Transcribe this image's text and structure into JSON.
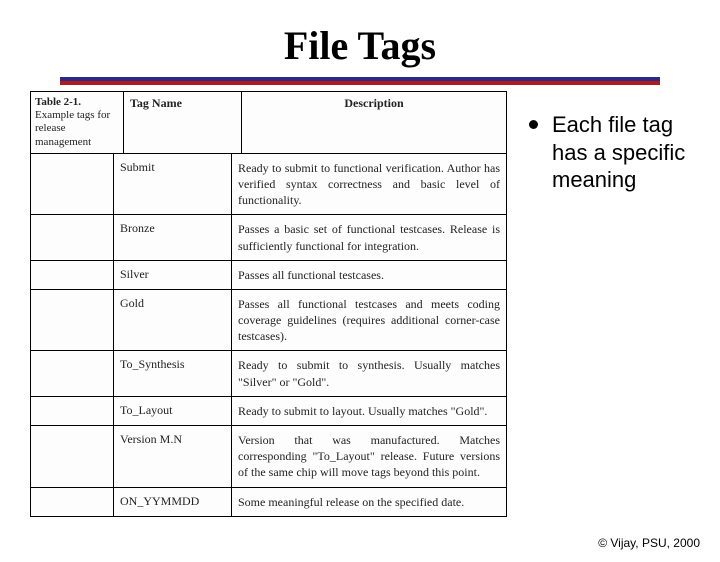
{
  "title": "File Tags",
  "side_label_line1": "Table 2-1.",
  "side_label_rest": "Example tags for release management",
  "columns": {
    "tag": "Tag Name",
    "desc": "Description"
  },
  "rows": [
    {
      "tag": "Submit",
      "desc": "Ready to submit to functional verification. Author has verified syntax correctness and basic level of functionality."
    },
    {
      "tag": "Bronze",
      "desc": "Passes a basic set of functional testcases. Release is sufficiently functional for integration."
    },
    {
      "tag": "Silver",
      "desc": "Passes all functional testcases."
    },
    {
      "tag": "Gold",
      "desc": "Passes all functional testcases and meets coding coverage guidelines (requires additional corner-case testcases)."
    },
    {
      "tag": "To_Synthesis",
      "desc": "Ready to submit to synthesis. Usually matches \"Silver\" or \"Gold\"."
    },
    {
      "tag": "To_Layout",
      "desc": "Ready to submit to layout. Usually matches \"Gold\"."
    },
    {
      "tag": "Version M.N",
      "desc": "Version that was manufactured. Matches corresponding \"To_Layout\" release. Future versions of the same chip will move tags beyond this point."
    },
    {
      "tag": "ON_YYMMDD",
      "desc": "Some meaningful release on the specified date."
    }
  ],
  "bullet": "Each file tag has a specific meaning",
  "footer": "© Vijay, PSU, 2000"
}
